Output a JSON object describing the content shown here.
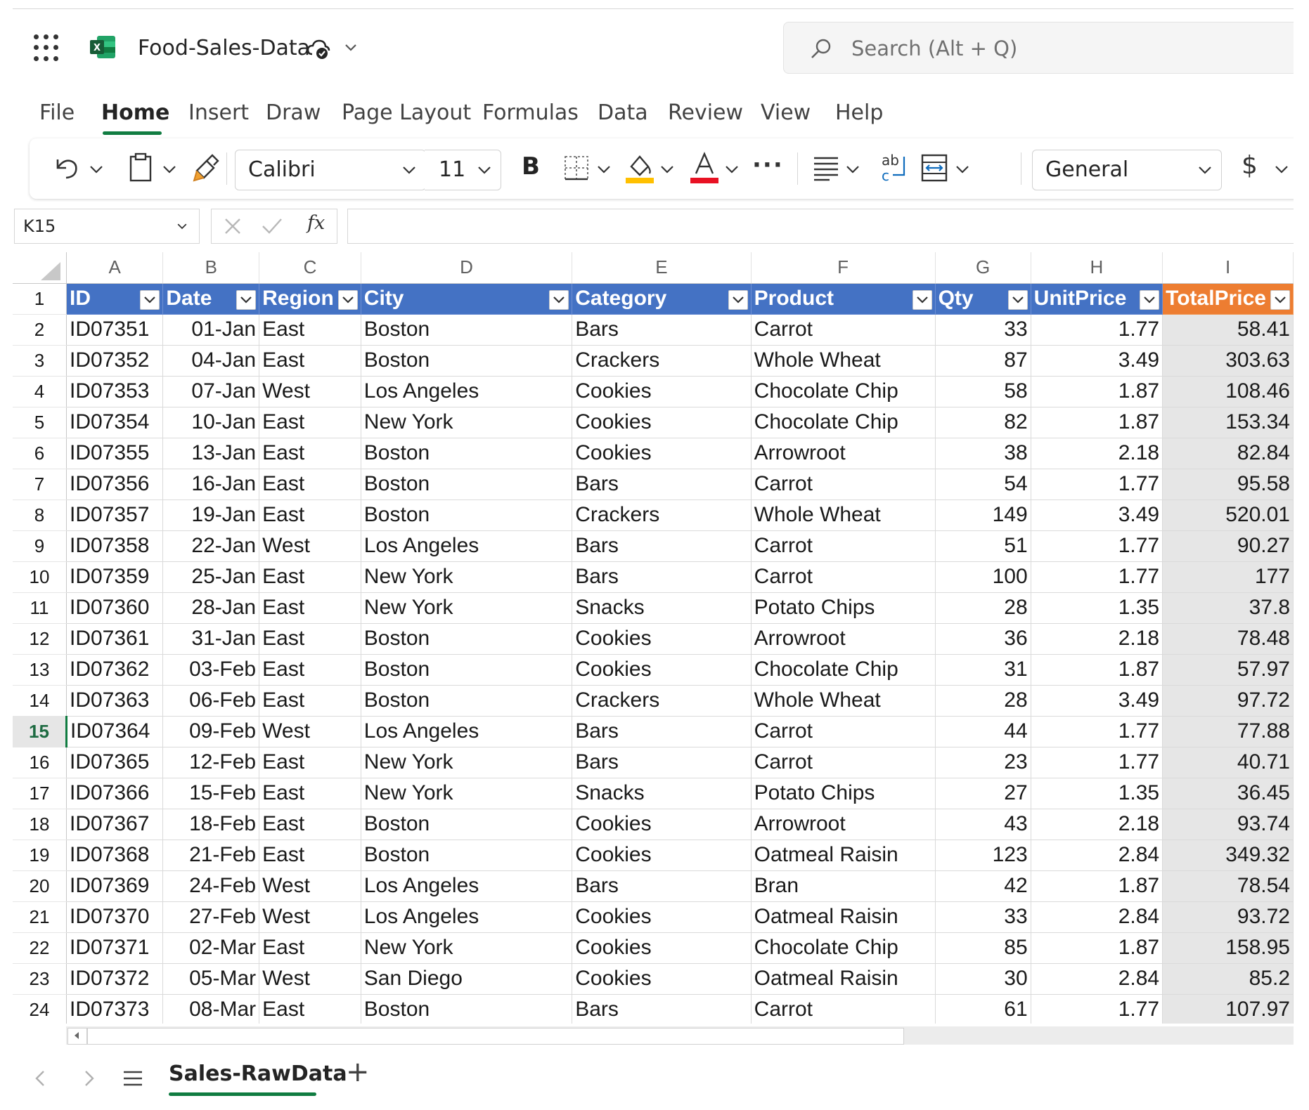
{
  "app": {
    "document_title": "Food-Sales-Data",
    "search_placeholder": "Search (Alt + Q)"
  },
  "ribbon_tabs": [
    "File",
    "Home",
    "Insert",
    "Draw",
    "Page Layout",
    "Formulas",
    "Data",
    "Review",
    "View",
    "Help"
  ],
  "active_tab": "Home",
  "toolbar": {
    "font_name": "Calibri",
    "font_size": "11",
    "bold_label": "B",
    "number_format": "General",
    "currency_label": "$",
    "more_label": "···",
    "font_color_hex": "#e81123",
    "fill_color_hex": "#ffc000"
  },
  "formula_bar": {
    "name_box": "K15",
    "fx_label": "fx",
    "formula_value": ""
  },
  "column_letters": [
    "A",
    "B",
    "C",
    "D",
    "E",
    "F",
    "G",
    "H",
    "I"
  ],
  "table": {
    "header_color": "#4472c4",
    "selected_header_color": "#ed7d31",
    "headers": [
      "ID",
      "Date",
      "Region",
      "City",
      "Category",
      "Product",
      "Qty",
      "UnitPrice",
      "TotalPrice"
    ],
    "rows": [
      [
        "2",
        "ID07351",
        "01-Jan",
        "East",
        "Boston",
        "Bars",
        "Carrot",
        "33",
        "1.77",
        "58.41"
      ],
      [
        "3",
        "ID07352",
        "04-Jan",
        "East",
        "Boston",
        "Crackers",
        "Whole Wheat",
        "87",
        "3.49",
        "303.63"
      ],
      [
        "4",
        "ID07353",
        "07-Jan",
        "West",
        "Los Angeles",
        "Cookies",
        "Chocolate Chip",
        "58",
        "1.87",
        "108.46"
      ],
      [
        "5",
        "ID07354",
        "10-Jan",
        "East",
        "New York",
        "Cookies",
        "Chocolate Chip",
        "82",
        "1.87",
        "153.34"
      ],
      [
        "6",
        "ID07355",
        "13-Jan",
        "East",
        "Boston",
        "Cookies",
        "Arrowroot",
        "38",
        "2.18",
        "82.84"
      ],
      [
        "7",
        "ID07356",
        "16-Jan",
        "East",
        "Boston",
        "Bars",
        "Carrot",
        "54",
        "1.77",
        "95.58"
      ],
      [
        "8",
        "ID07357",
        "19-Jan",
        "East",
        "Boston",
        "Crackers",
        "Whole Wheat",
        "149",
        "3.49",
        "520.01"
      ],
      [
        "9",
        "ID07358",
        "22-Jan",
        "West",
        "Los Angeles",
        "Bars",
        "Carrot",
        "51",
        "1.77",
        "90.27"
      ],
      [
        "10",
        "ID07359",
        "25-Jan",
        "East",
        "New York",
        "Bars",
        "Carrot",
        "100",
        "1.77",
        "177"
      ],
      [
        "11",
        "ID07360",
        "28-Jan",
        "East",
        "New York",
        "Snacks",
        "Potato Chips",
        "28",
        "1.35",
        "37.8"
      ],
      [
        "12",
        "ID07361",
        "31-Jan",
        "East",
        "Boston",
        "Cookies",
        "Arrowroot",
        "36",
        "2.18",
        "78.48"
      ],
      [
        "13",
        "ID07362",
        "03-Feb",
        "East",
        "Boston",
        "Cookies",
        "Chocolate Chip",
        "31",
        "1.87",
        "57.97"
      ],
      [
        "14",
        "ID07363",
        "06-Feb",
        "East",
        "Boston",
        "Crackers",
        "Whole Wheat",
        "28",
        "3.49",
        "97.72"
      ],
      [
        "15",
        "ID07364",
        "09-Feb",
        "West",
        "Los Angeles",
        "Bars",
        "Carrot",
        "44",
        "1.77",
        "77.88"
      ],
      [
        "16",
        "ID07365",
        "12-Feb",
        "East",
        "New York",
        "Bars",
        "Carrot",
        "23",
        "1.77",
        "40.71"
      ],
      [
        "17",
        "ID07366",
        "15-Feb",
        "East",
        "New York",
        "Snacks",
        "Potato Chips",
        "27",
        "1.35",
        "36.45"
      ],
      [
        "18",
        "ID07367",
        "18-Feb",
        "East",
        "Boston",
        "Cookies",
        "Arrowroot",
        "43",
        "2.18",
        "93.74"
      ],
      [
        "19",
        "ID07368",
        "21-Feb",
        "East",
        "Boston",
        "Cookies",
        "Oatmeal Raisin",
        "123",
        "2.84",
        "349.32"
      ],
      [
        "20",
        "ID07369",
        "24-Feb",
        "West",
        "Los Angeles",
        "Bars",
        "Bran",
        "42",
        "1.87",
        "78.54"
      ],
      [
        "21",
        "ID07370",
        "27-Feb",
        "West",
        "Los Angeles",
        "Cookies",
        "Oatmeal Raisin",
        "33",
        "2.84",
        "93.72"
      ],
      [
        "22",
        "ID07371",
        "02-Mar",
        "East",
        "New York",
        "Cookies",
        "Chocolate Chip",
        "85",
        "1.87",
        "158.95"
      ],
      [
        "23",
        "ID07372",
        "05-Mar",
        "West",
        "San Diego",
        "Cookies",
        "Oatmeal Raisin",
        "30",
        "2.84",
        "85.2"
      ],
      [
        "24",
        "ID07373",
        "08-Mar",
        "East",
        "Boston",
        "Bars",
        "Carrot",
        "61",
        "1.77",
        "107.97"
      ]
    ],
    "selected_row": "15"
  },
  "sheet_tabs": {
    "active": "Sales-RawData",
    "add_label": "+"
  }
}
